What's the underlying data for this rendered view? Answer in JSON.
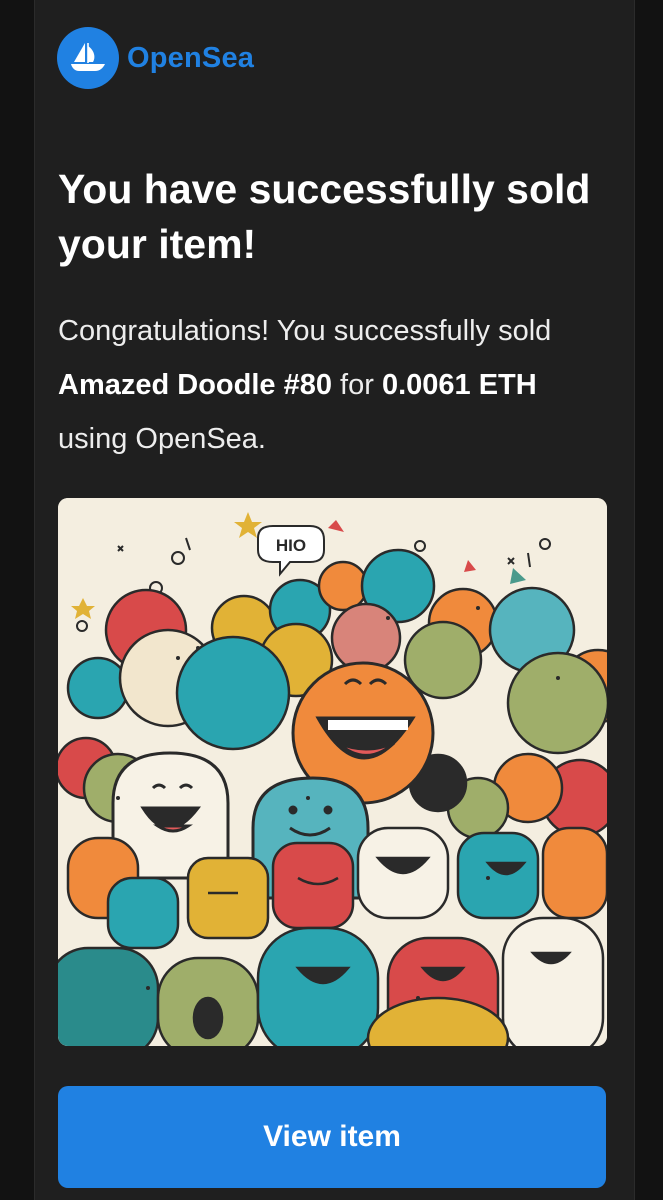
{
  "brand": {
    "name": "OpenSea",
    "logo_icon": "opensea-boat-icon",
    "color": "#2081e2"
  },
  "email": {
    "title": "You have successfully sold your item!",
    "message": {
      "intro": "Congratulations! You successfully sold ",
      "item_name": "Amazed Doodle #80",
      "for_text": " for ",
      "price": "0.0061 ETH",
      "outro": " using OpenSea."
    },
    "image": {
      "alt": "Amazed Doodle #80",
      "speech_text": "HIO"
    },
    "cta_label": "View item"
  },
  "theme": {
    "background": "#121212",
    "card": "#1f1f1f",
    "accent": "#2081e2"
  }
}
